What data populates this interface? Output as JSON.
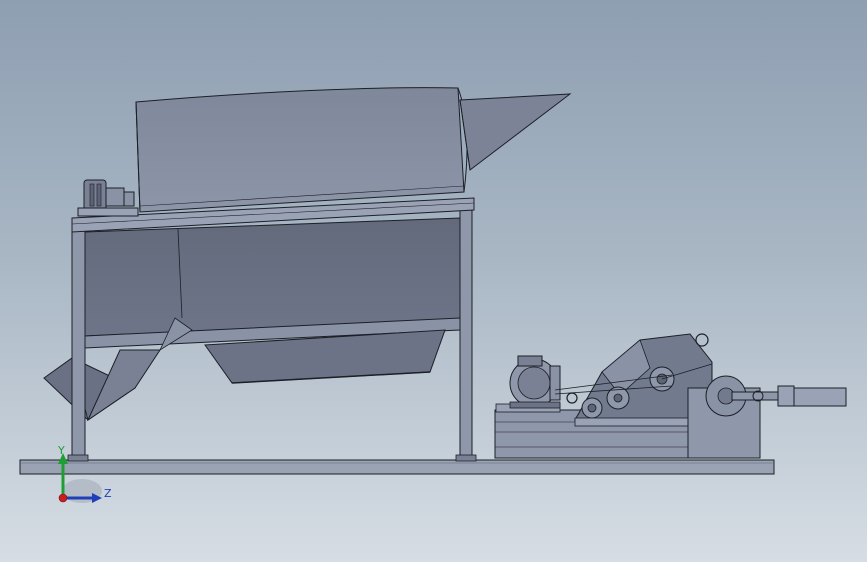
{
  "triad": {
    "y_label": "Y",
    "z_label": "Z",
    "y_color": "#1e9e33",
    "z_color": "#1f3fb8",
    "x_color": "#c81e1e"
  },
  "colors": {
    "metal_light": "#8f97ab",
    "metal_mid": "#727a8e",
    "metal_dark": "#5d6476",
    "edge": "#1c1f26",
    "base": "#9aa3b3"
  }
}
